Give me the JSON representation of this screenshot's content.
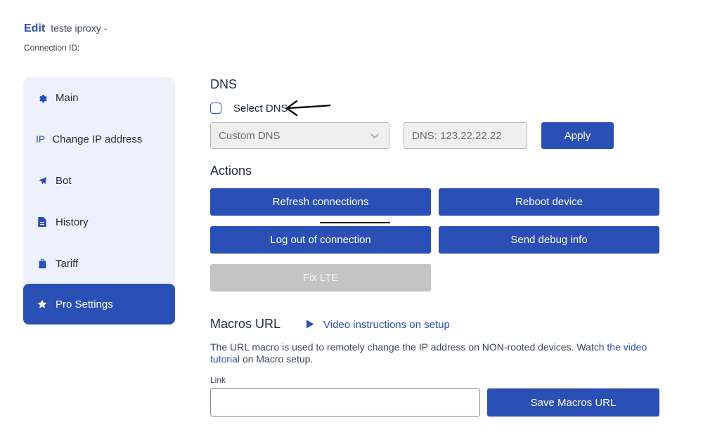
{
  "header": {
    "edit_label": "Edit",
    "connection_name": "teste iproxy -",
    "connection_id_label": "Connection ID:"
  },
  "sidebar": {
    "items": [
      {
        "label": "Main",
        "icon": "gear-icon"
      },
      {
        "label": "Change IP address",
        "icon_text": "IP"
      },
      {
        "label": "Bot",
        "icon": "telegram-icon"
      },
      {
        "label": "History",
        "icon": "document-icon"
      },
      {
        "label": "Tariff",
        "icon": "bag-icon"
      },
      {
        "label": "Pro Settings",
        "icon": "star-icon",
        "active": true
      }
    ]
  },
  "dns": {
    "title": "DNS",
    "select_dns_label": "Select DNS",
    "select_dns_checked": false,
    "dns_select_value": "Custom DNS",
    "dns_input_value": "DNS: 123.22.22.22",
    "apply_label": "Apply"
  },
  "actions": {
    "title": "Actions",
    "refresh_label": "Refresh connections",
    "reboot_label": "Reboot device",
    "logout_label": "Log out of connection",
    "debug_label": "Send debug info",
    "fix_lte_label": "Fix LTE"
  },
  "macros": {
    "title": "Macros URL",
    "video_link": "Video instructions on setup",
    "desc_before": "The URL macro is used to remotely change the IP address on NON-rooted devices. Watch",
    "desc_link": "the video tutorial",
    "desc_after": "on Macro setup.",
    "link_label": "Link",
    "link_value": "",
    "save_label": "Save Macros URL"
  },
  "colors": {
    "accent": "#2a4fb5",
    "sidebar_bg": "#eef1fb",
    "disabled": "#c4c4c4"
  }
}
